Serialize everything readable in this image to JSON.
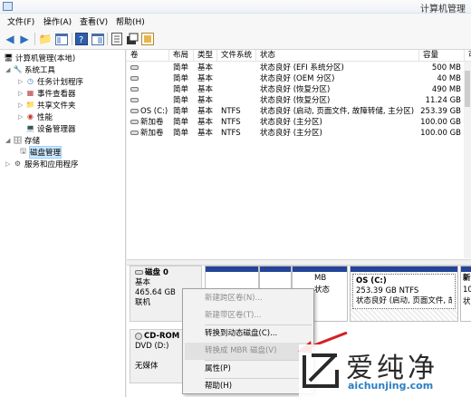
{
  "window": {
    "title": "计算机管理"
  },
  "menu": [
    "文件(F)",
    "操作(A)",
    "查看(V)",
    "帮助(H)"
  ],
  "toolbar": {
    "icons": [
      "back-arrow-icon",
      "forward-arrow-icon",
      "folder-up-icon",
      "show-tree-icon",
      "help-icon",
      "properties-icon",
      "export-icon",
      "refresh-icon",
      "help-book-icon"
    ]
  },
  "tree": {
    "root": "计算机管理(本地)",
    "system_tools": "系统工具",
    "task_scheduler": "任务计划程序",
    "event_viewer": "事件查看器",
    "shared_folders": "共享文件夹",
    "performance": "性能",
    "device_manager": "设备管理器",
    "storage": "存储",
    "disk_management": "磁盘管理",
    "services_apps": "服务和应用程序"
  },
  "volume_table": {
    "columns": [
      "卷",
      "布局",
      "类型",
      "文件系统",
      "状态",
      "容量",
      "可"
    ],
    "rows": [
      {
        "volume": "",
        "layout": "简单",
        "type": "基本",
        "fs": "",
        "status": "状态良好 (EFI 系统分区)",
        "capacity": "500 MB"
      },
      {
        "volume": "",
        "layout": "简单",
        "type": "基本",
        "fs": "",
        "status": "状态良好 (OEM 分区)",
        "capacity": "40 MB"
      },
      {
        "volume": "",
        "layout": "简单",
        "type": "基本",
        "fs": "",
        "status": "状态良好 (恢复分区)",
        "capacity": "490 MB"
      },
      {
        "volume": "",
        "layout": "简单",
        "type": "基本",
        "fs": "",
        "status": "状态良好 (恢复分区)",
        "capacity": "11.24 GB"
      },
      {
        "volume": "OS (C:)",
        "layout": "简单",
        "type": "基本",
        "fs": "NTFS",
        "status": "状态良好 (启动, 页面文件, 故障转储, 主分区)",
        "capacity": "253.39 GB"
      },
      {
        "volume": "新加卷",
        "layout": "简单",
        "type": "基本",
        "fs": "NTFS",
        "status": "状态良好 (主分区)",
        "capacity": "100.00 GB"
      },
      {
        "volume": "新加卷",
        "layout": "简单",
        "type": "基本",
        "fs": "NTFS",
        "status": "状态良好 (主分区)",
        "capacity": "100.00 GB"
      }
    ]
  },
  "disk0": {
    "name": "磁盘 0",
    "type": "基本",
    "size": "465.64 GB",
    "status": "联机",
    "partition_small_text": "MB",
    "partition_small_status": "状态",
    "partition_c": {
      "title": "OS  (C:)",
      "detail": "253.39 GB NTFS",
      "status": "状态良好 (启动, 页面文件, 故"
    },
    "partition_next": {
      "title": "新",
      "detail": "10",
      "status": "状"
    }
  },
  "cdrom": {
    "name": "CD-ROM",
    "drive": "DVD (D:)",
    "media": "无媒体"
  },
  "context_menu": {
    "items": [
      {
        "label": "新建跨区卷(N)...",
        "enabled": false
      },
      {
        "label": "新建带区卷(T)...",
        "enabled": false
      },
      {
        "label": "转换到动态磁盘(C)...",
        "enabled": true
      },
      {
        "label": "转换成 MBR 磁盘(V)",
        "enabled": false
      },
      {
        "label": "属性(P)",
        "enabled": true
      },
      {
        "label": "帮助(H)",
        "enabled": true
      }
    ]
  },
  "watermark": {
    "cn": "爱纯净",
    "url": "aichunjing.com"
  },
  "colors": {
    "partition_bar": "#24449a",
    "arrow": "#d42020",
    "selection": "#cce8ff"
  }
}
